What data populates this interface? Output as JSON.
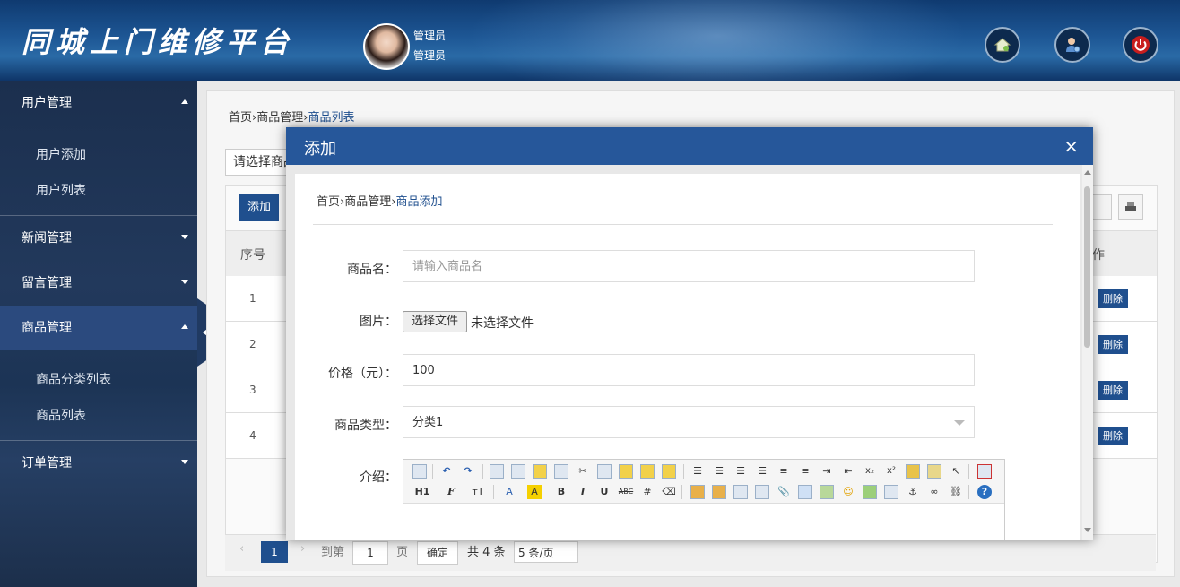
{
  "header": {
    "logo": "同城上门维修平台",
    "user_role": "管理员",
    "user_name": "管理员",
    "buttons": [
      "home-icon",
      "user-settings-icon",
      "power-icon"
    ]
  },
  "sidebar": {
    "menus": [
      {
        "label": "用户管理",
        "expanded": true,
        "items": [
          "用户添加",
          "用户列表"
        ]
      },
      {
        "label": "新闻管理",
        "expanded": false
      },
      {
        "label": "留言管理",
        "expanded": false
      },
      {
        "label": "商品管理",
        "expanded": true,
        "items": [
          "商品分类列表",
          "商品列表"
        ]
      },
      {
        "label": "订单管理",
        "expanded": false
      }
    ]
  },
  "main": {
    "breadcrumb": {
      "home": "首页",
      "section": "商品管理",
      "current": "商品列表"
    },
    "select_placeholder": "请选择商品",
    "add_button": "添加",
    "col_no": "序号",
    "col_action": "作",
    "rows": [
      {
        "no": "1",
        "action": "删除"
      },
      {
        "no": "2",
        "action": "删除"
      },
      {
        "no": "3",
        "action": "删除"
      },
      {
        "no": "4",
        "action": "删除"
      }
    ],
    "pager": {
      "page": "1",
      "goto_label": "到第",
      "goto_value": "1",
      "page_unit": "页",
      "confirm": "确定",
      "total": "共 4 条",
      "page_size": "5 条/页"
    }
  },
  "modal": {
    "title": "添加",
    "close": "×",
    "breadcrumb": {
      "home": "首页",
      "section": "商品管理",
      "current": "商品添加"
    },
    "fields": {
      "name_label": "商品名：",
      "name_placeholder": "请输入商品名",
      "image_label": "图片：",
      "file_button": "选择文件",
      "file_status": "未选择文件",
      "price_label": "价格（元）：",
      "price_value": "100",
      "type_label": "商品类型：",
      "type_value": "分类1",
      "intro_label": "介绍："
    },
    "toolbar_text": {
      "h1": "H1",
      "font": "F",
      "size": "тT",
      "color": "A",
      "highlight": "A",
      "bold": "B",
      "italic": "I",
      "underline": "U",
      "strike": "ABC",
      "sub": "x₂",
      "sup": "x²"
    }
  },
  "colors": {
    "brand": "#26579a",
    "sidebar": "#1b2f4e",
    "button": "#1f4f8e"
  }
}
